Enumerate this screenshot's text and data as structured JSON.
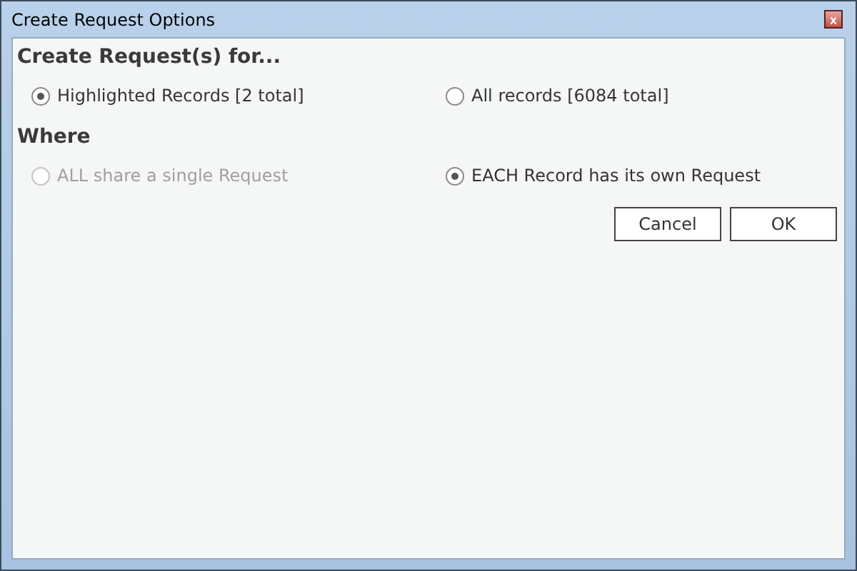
{
  "window": {
    "title": "Create Request Options",
    "close_label": "x"
  },
  "sections": [
    {
      "heading": "Create Request(s) for...",
      "options": [
        {
          "label": "Highlighted Records [2 total]",
          "selected": true,
          "disabled": false
        },
        {
          "label": "All records [6084 total]",
          "selected": false,
          "disabled": false
        }
      ]
    },
    {
      "heading": "Where",
      "options": [
        {
          "label": "ALL share a single Request",
          "selected": false,
          "disabled": true
        },
        {
          "label": "EACH Record has its own Request",
          "selected": true,
          "disabled": false
        }
      ]
    }
  ],
  "buttons": [
    "Cancel",
    "OK"
  ]
}
